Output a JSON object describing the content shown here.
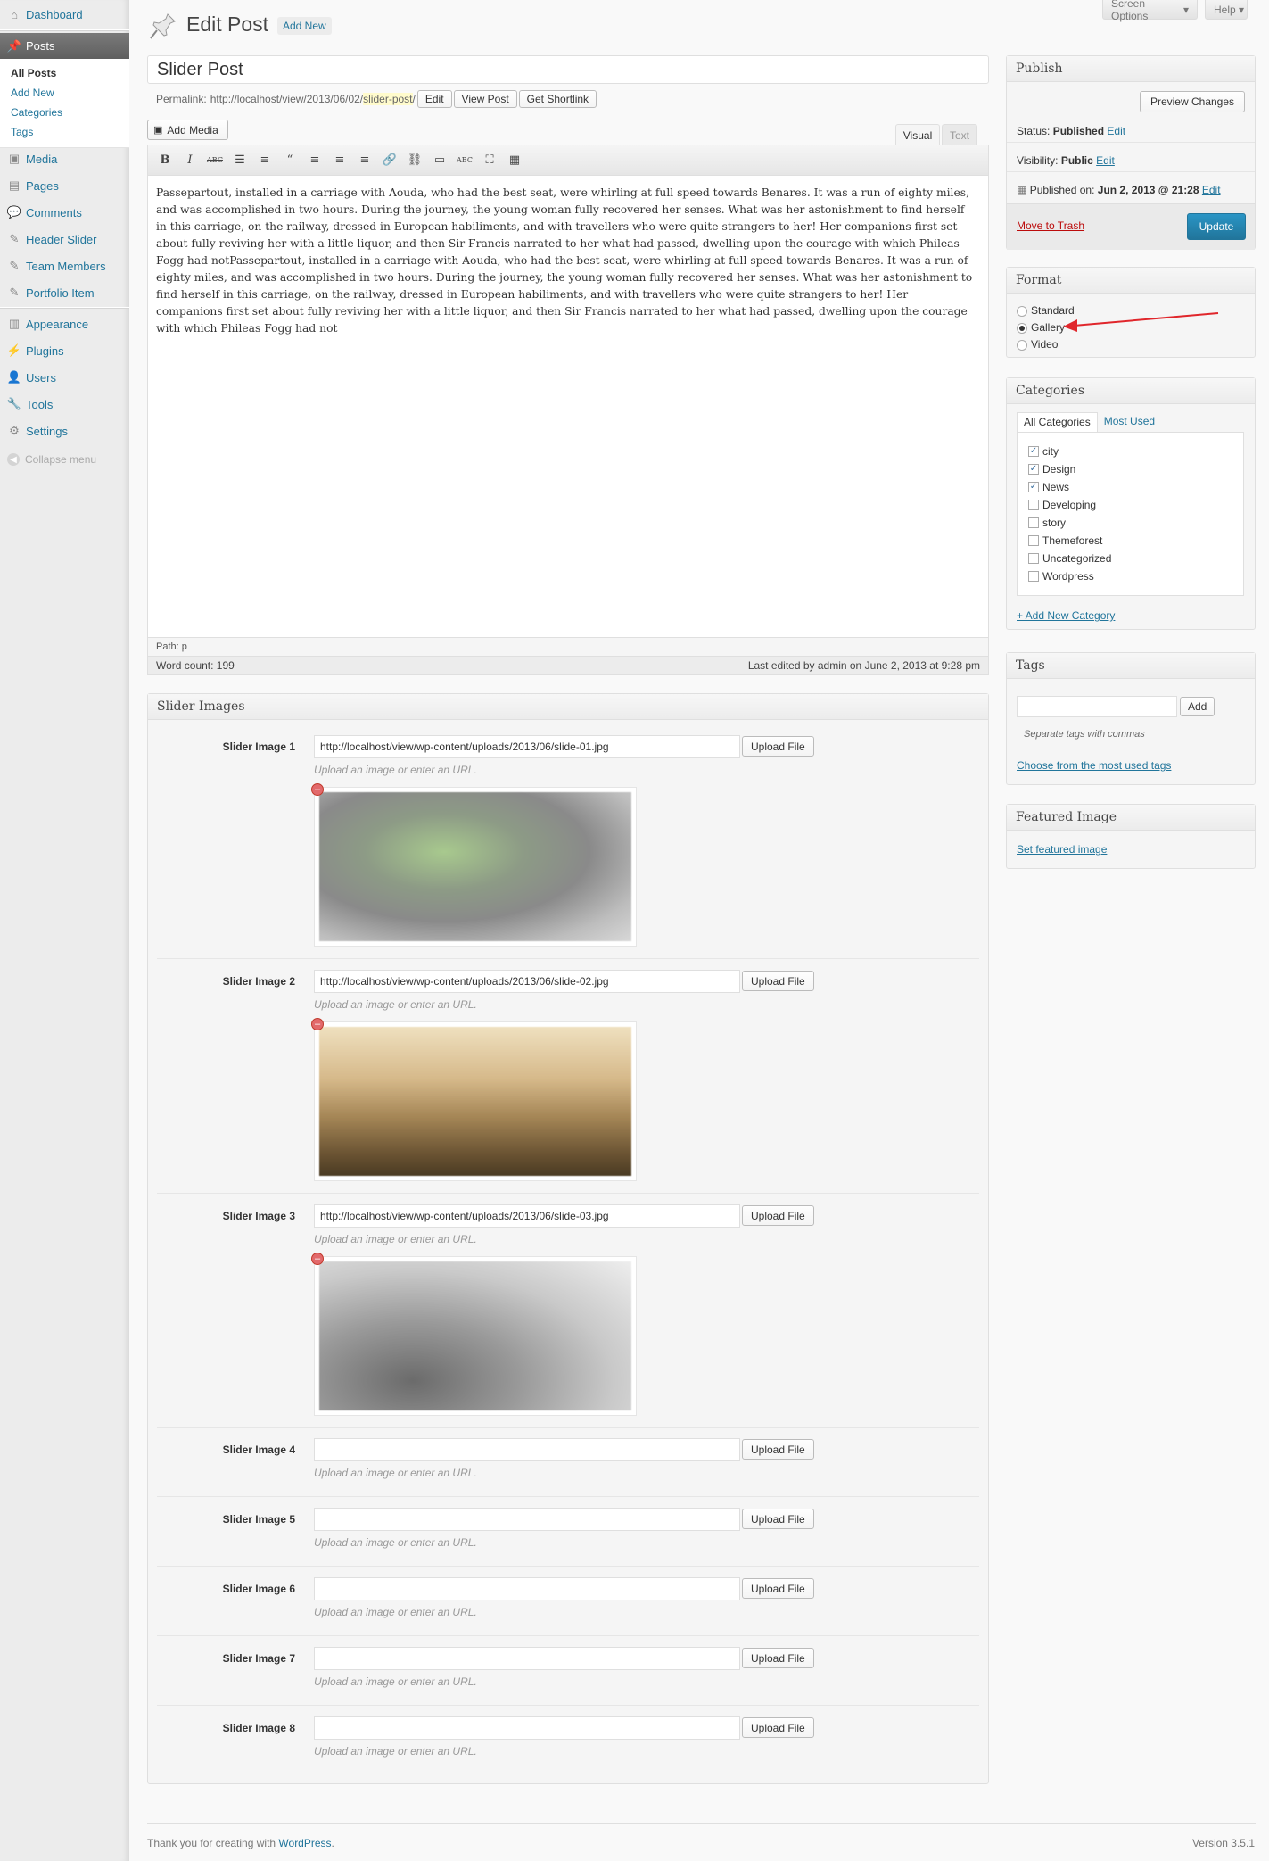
{
  "sidebar": {
    "items": [
      {
        "label": "Dashboard",
        "icon": "dashboard-icon"
      },
      {
        "label": "Posts",
        "icon": "pin-icon"
      },
      {
        "label": "Media",
        "icon": "media-icon"
      },
      {
        "label": "Pages",
        "icon": "pages-icon"
      },
      {
        "label": "Comments",
        "icon": "comments-icon"
      },
      {
        "label": "Header Slider",
        "icon": "slider-icon"
      },
      {
        "label": "Team Members",
        "icon": "team-icon"
      },
      {
        "label": "Portfolio Item",
        "icon": "portfolio-icon"
      },
      {
        "label": "Appearance",
        "icon": "appearance-icon"
      },
      {
        "label": "Plugins",
        "icon": "plugins-icon"
      },
      {
        "label": "Users",
        "icon": "users-icon"
      },
      {
        "label": "Tools",
        "icon": "tools-icon"
      },
      {
        "label": "Settings",
        "icon": "settings-icon"
      }
    ],
    "submenu": [
      "All Posts",
      "Add New",
      "Categories",
      "Tags"
    ],
    "collapse_label": "Collapse menu"
  },
  "screen_meta": {
    "screen_options": "Screen Options",
    "help": "Help"
  },
  "header": {
    "title": "Edit Post",
    "add_new": "Add New"
  },
  "post": {
    "title": "Slider Post",
    "permalink_label": "Permalink:",
    "permalink_base": "http://localhost/view/2013/06/02/",
    "permalink_slug": "slider-post",
    "permalink_end": "/",
    "edit_btn": "Edit",
    "view_btn": "View Post",
    "shortlink_btn": "Get Shortlink"
  },
  "editor": {
    "add_media": "Add Media",
    "tab_visual": "Visual",
    "tab_text": "Text",
    "content": "Passepartout, installed in a carriage with Aouda, who had the best seat, were whirling at full speed towards Benares. It was a run of eighty miles, and was accomplished in two hours. During the journey, the young woman fully recovered her senses. What was her astonishment to find herself in this carriage, on the railway, dressed in European habiliments, and with travellers who were quite strangers to her! Her companions first set about fully reviving her with a little liquor, and then Sir Francis narrated to her what had passed, dwelling upon the courage with which Phileas Fogg had notPassepartout, installed in a carriage with Aouda, who had the best seat, were whirling at full speed towards Benares. It was a run of eighty miles, and was accomplished in two hours. During the journey, the young woman fully recovered her senses. What was her astonishment to find herself in this carriage, on the railway, dressed in European habiliments, and with travellers who were quite strangers to her! Her companions first set about fully reviving her with a little liquor, and then Sir Francis narrated to her what had passed, dwelling upon the courage with which Phileas Fogg had not",
    "path": "Path: p",
    "word_count": "Word count: 199",
    "last_edited": "Last edited by admin on June 2, 2013 at 9:28 pm",
    "toolbar": [
      {
        "glyph": "B",
        "icon": "bold-icon"
      },
      {
        "glyph": "I",
        "icon": "italic-icon"
      },
      {
        "glyph": "ABC",
        "icon": "strikethrough-icon"
      },
      {
        "glyph": "☰",
        "icon": "bullet-list-icon"
      },
      {
        "glyph": "≡",
        "icon": "numbered-list-icon"
      },
      {
        "glyph": "“",
        "icon": "blockquote-icon"
      },
      {
        "glyph": "≡",
        "icon": "align-left-icon"
      },
      {
        "glyph": "≡",
        "icon": "align-center-icon"
      },
      {
        "glyph": "≡",
        "icon": "align-right-icon"
      },
      {
        "glyph": "🔗",
        "icon": "link-icon"
      },
      {
        "glyph": "⛓",
        "icon": "unlink-icon"
      },
      {
        "glyph": "▭",
        "icon": "more-tag-icon"
      },
      {
        "glyph": "ABC",
        "icon": "spellcheck-icon"
      },
      {
        "glyph": "⛶",
        "icon": "fullscreen-icon"
      },
      {
        "glyph": "▦",
        "icon": "kitchen-sink-icon"
      }
    ]
  },
  "slider_box": {
    "title": "Slider Images",
    "upload_btn": "Upload File",
    "desc": "Upload an image or enter an URL.",
    "images": [
      {
        "label": "Slider Image 1",
        "value": "http://localhost/view/wp-content/uploads/2013/06/slide-01.jpg"
      },
      {
        "label": "Slider Image 2",
        "value": "http://localhost/view/wp-content/uploads/2013/06/slide-02.jpg"
      },
      {
        "label": "Slider Image 3",
        "value": "http://localhost/view/wp-content/uploads/2013/06/slide-03.jpg"
      },
      {
        "label": "Slider Image 4",
        "value": ""
      },
      {
        "label": "Slider Image 5",
        "value": ""
      },
      {
        "label": "Slider Image 6",
        "value": ""
      },
      {
        "label": "Slider Image 7",
        "value": ""
      },
      {
        "label": "Slider Image 8",
        "value": ""
      }
    ]
  },
  "publish": {
    "title": "Publish",
    "preview_btn": "Preview Changes",
    "status_label": "Status:",
    "status_value": "Published",
    "visibility_label": "Visibility:",
    "visibility_value": "Public",
    "published_label": "Published on:",
    "published_value": "Jun 2, 2013 @ 21:28",
    "edit_link": "Edit",
    "trash": "Move to Trash",
    "update": "Update"
  },
  "format": {
    "title": "Format",
    "options": [
      "Standard",
      "Gallery",
      "Video"
    ],
    "selected": "Gallery"
  },
  "categories": {
    "title": "Categories",
    "tab_all": "All Categories",
    "tab_used": "Most Used",
    "items": [
      {
        "name": "city",
        "checked": true
      },
      {
        "name": "Design",
        "checked": true
      },
      {
        "name": "News",
        "checked": true
      },
      {
        "name": "Developing",
        "checked": false
      },
      {
        "name": "story",
        "checked": false
      },
      {
        "name": "Themeforest",
        "checked": false
      },
      {
        "name": "Uncategorized",
        "checked": false
      },
      {
        "name": "Wordpress",
        "checked": false
      }
    ],
    "add_new": "+ Add New Category"
  },
  "tags": {
    "title": "Tags",
    "add_btn": "Add",
    "hint": "Separate tags with commas",
    "choose": "Choose from the most used tags"
  },
  "featured": {
    "title": "Featured Image",
    "set": "Set featured image"
  },
  "footer": {
    "thanks": "Thank you for creating with ",
    "wp": "WordPress",
    "wp_end": ".",
    "version": "Version 3.5.1"
  },
  "colors": {
    "link": "#21759b",
    "primary": "#21759b",
    "trash": "#bc0b0b",
    "annotation": "#e0262b"
  }
}
